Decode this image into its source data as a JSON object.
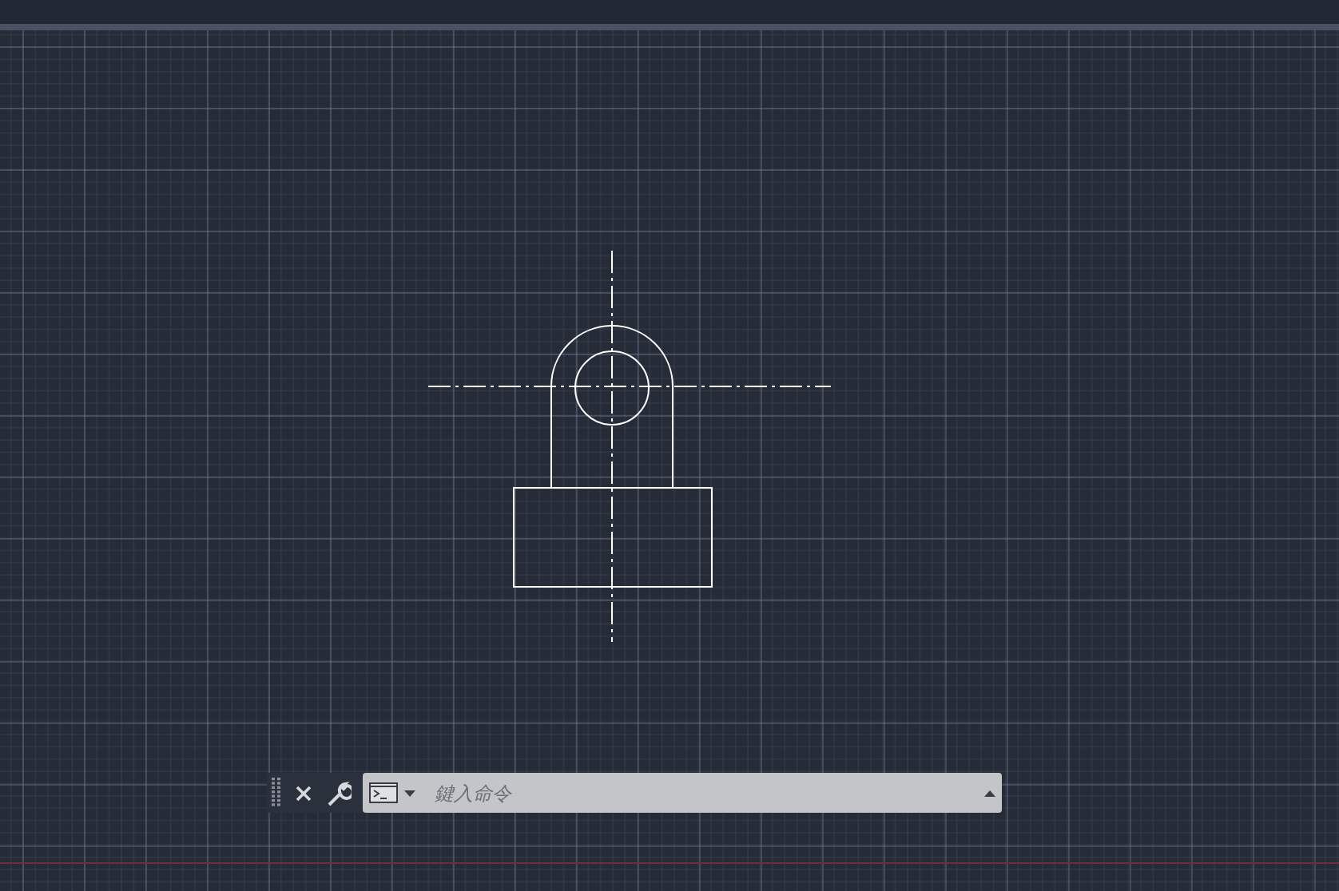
{
  "command_line": {
    "placeholder": "鍵入命令"
  }
}
